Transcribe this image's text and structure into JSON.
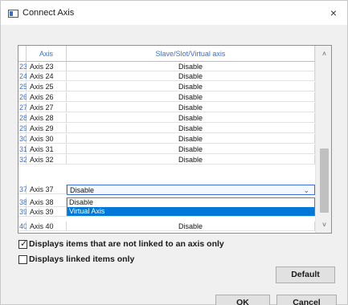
{
  "window": {
    "title": "Connect Axis",
    "close_glyph": "×"
  },
  "table": {
    "headers": {
      "number": "",
      "axis": "Axis",
      "slave": "Slave/Slot/Virtual axis"
    },
    "rows": [
      {
        "number": "23",
        "axis": "Axis 23",
        "slave": "Disable"
      },
      {
        "number": "24",
        "axis": "Axis 24",
        "slave": "Disable"
      },
      {
        "number": "25",
        "axis": "Axis 25",
        "slave": "Disable"
      },
      {
        "number": "26",
        "axis": "Axis 26",
        "slave": "Disable"
      },
      {
        "number": "27",
        "axis": "Axis 27",
        "slave": "Disable"
      },
      {
        "number": "28",
        "axis": "Axis 28",
        "slave": "Disable"
      },
      {
        "number": "29",
        "axis": "Axis 29",
        "slave": "Disable"
      },
      {
        "number": "30",
        "axis": "Axis 30",
        "slave": "Disable"
      },
      {
        "number": "31",
        "axis": "Axis 31",
        "slave": "Disable"
      },
      {
        "number": "32",
        "axis": "Axis 32",
        "slave": "Disable"
      },
      {
        "number": "37",
        "axis": "Axis 37",
        "slave": "Disable"
      },
      {
        "number": "38",
        "axis": "Axis 38",
        "slave": ""
      },
      {
        "number": "39",
        "axis": "Axis 39",
        "slave": ""
      },
      {
        "number": "40",
        "axis": "Axis 40",
        "slave": "Disable"
      }
    ],
    "dropdown_options": [
      "Disable",
      "Virtual Axis"
    ],
    "dropdown_arrow": "⌄",
    "scroll_up_glyph": "˄",
    "scroll_down_glyph": "˅"
  },
  "options": {
    "unlinked_only_label": "Displays items that are not linked to an axis only",
    "unlinked_only_checked": true,
    "linked_only_label": "Displays linked items only",
    "linked_only_checked": false
  },
  "buttons": {
    "default": "Default",
    "ok": "OK",
    "cancel": "Cancel"
  },
  "colors": {
    "header_text": "#3b6fd6",
    "selection": "#0078d7"
  }
}
